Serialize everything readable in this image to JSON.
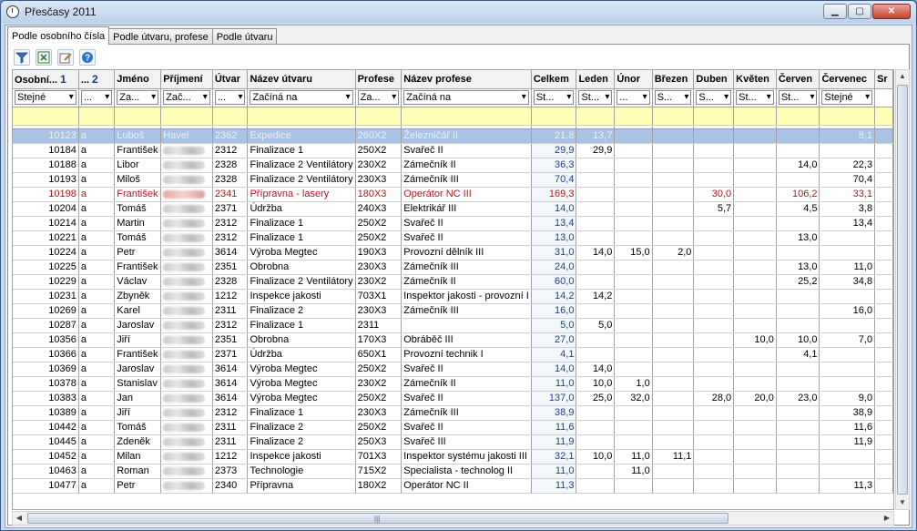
{
  "window": {
    "title": "Přesčasy 2011"
  },
  "tabs": [
    "Podle osobního čísla",
    "Podle útvaru, profese",
    "Podle útvaru"
  ],
  "toolbar": [
    "filter-icon",
    "excel-export-icon",
    "edit-icon",
    "help-icon"
  ],
  "columns": [
    "Osobní...",
    "...",
    "Jméno",
    "Příjmení",
    "Útvar",
    "Název útvaru",
    "Profese",
    "Název profese",
    "Celkem",
    "Leden",
    "Únor",
    "Březen",
    "Duben",
    "Květen",
    "Červen",
    "Červenec",
    "Sr"
  ],
  "sort_marks": [
    "1",
    "2"
  ],
  "filters": [
    "Stejné",
    "...",
    "Za...",
    "Zač...",
    "...",
    "Začíná na",
    "Za...",
    "Začíná na",
    "St...",
    "St...",
    "...",
    "S...",
    "S...",
    "St...",
    "St...",
    "Stejné",
    ""
  ],
  "rows": [
    {
      "cells": [
        "10123",
        "a",
        "Luboš",
        "Havel",
        "2362",
        "Expedice",
        "260X2",
        "Železničář II",
        "21,8",
        "13,7",
        "",
        "",
        "",
        "",
        "",
        "8,1"
      ],
      "state": "selected"
    },
    {
      "cells": [
        "10184",
        "a",
        "František",
        "",
        "2312",
        "Finalizace 1",
        "250X2",
        "Svařeč II",
        "29,9",
        "29,9",
        "",
        "",
        "",
        "",
        "",
        ""
      ]
    },
    {
      "cells": [
        "10188",
        "a",
        "Libor",
        "",
        "2328",
        "Finalizace 2 Ventilátory",
        "230X2",
        "Zámečník II",
        "36,3",
        "",
        "",
        "",
        "",
        "",
        "14,0",
        "22,3"
      ]
    },
    {
      "cells": [
        "10193",
        "a",
        "Miloš",
        "",
        "2328",
        "Finalizace 2 Ventilátory",
        "230X3",
        "Zámečník III",
        "70,4",
        "",
        "",
        "",
        "",
        "",
        "",
        "70,4"
      ]
    },
    {
      "cells": [
        "10198",
        "a",
        "František",
        "",
        "2341",
        "Přípravna - lasery",
        "180X3",
        "Operátor NC III",
        "169,3",
        "",
        "",
        "",
        "30,0",
        "",
        "106,2",
        "33,1"
      ],
      "state": "red"
    },
    {
      "cells": [
        "10204",
        "a",
        "Tomáš",
        "",
        "2371",
        "Údržba",
        "240X3",
        "Elektrikář III",
        "14,0",
        "",
        "",
        "",
        "5,7",
        "",
        "4,5",
        "3,8"
      ]
    },
    {
      "cells": [
        "10214",
        "a",
        "Martin",
        "",
        "2312",
        "Finalizace 1",
        "250X2",
        "Svařeč II",
        "13,4",
        "",
        "",
        "",
        "",
        "",
        "",
        "13,4"
      ]
    },
    {
      "cells": [
        "10221",
        "a",
        "Tomáš",
        "",
        "2312",
        "Finalizace 1",
        "250X2",
        "Svařeč II",
        "13,0",
        "",
        "",
        "",
        "",
        "",
        "13,0",
        ""
      ]
    },
    {
      "cells": [
        "10224",
        "a",
        "Petr",
        "",
        "3614",
        "Výroba Megtec",
        "190X3",
        "Provozní dělník III",
        "31,0",
        "14,0",
        "15,0",
        "2,0",
        "",
        "",
        "",
        ""
      ]
    },
    {
      "cells": [
        "10225",
        "a",
        "František",
        "",
        "2351",
        "Obrobna",
        "230X3",
        "Zámečník III",
        "24,0",
        "",
        "",
        "",
        "",
        "",
        "13,0",
        "11,0"
      ]
    },
    {
      "cells": [
        "10229",
        "a",
        "Václav",
        "",
        "2328",
        "Finalizace 2 Ventilátory",
        "230X2",
        "Zámečník II",
        "60,0",
        "",
        "",
        "",
        "",
        "",
        "25,2",
        "34,8"
      ]
    },
    {
      "cells": [
        "10231",
        "a",
        "Zbyněk",
        "",
        "1212",
        "Inspekce jakosti",
        "703X1",
        "Inspektor jakosti - provozní I",
        "14,2",
        "14,2",
        "",
        "",
        "",
        "",
        "",
        ""
      ]
    },
    {
      "cells": [
        "10269",
        "a",
        "Karel",
        "",
        "2311",
        "Finalizace 2",
        "230X3",
        "Zámečník III",
        "16,0",
        "",
        "",
        "",
        "",
        "",
        "",
        "16,0"
      ]
    },
    {
      "cells": [
        "10287",
        "a",
        "Jaroslav",
        "",
        "2312",
        "Finalizace 1",
        "2311",
        "",
        "5,0",
        "5,0",
        "",
        "",
        "",
        "",
        "",
        ""
      ]
    },
    {
      "cells": [
        "10356",
        "a",
        "Jiří",
        "",
        "2351",
        "Obrobna",
        "170X3",
        "Obráběč III",
        "27,0",
        "",
        "",
        "",
        "",
        "10,0",
        "10,0",
        "7,0"
      ]
    },
    {
      "cells": [
        "10366",
        "a",
        "František",
        "",
        "2371",
        "Údržba",
        "650X1",
        "Provozní technik I",
        "4,1",
        "",
        "",
        "",
        "",
        "",
        "4,1",
        ""
      ]
    },
    {
      "cells": [
        "10369",
        "a",
        "Jaroslav",
        "",
        "3614",
        "Výroba Megtec",
        "250X2",
        "Svařeč II",
        "14,0",
        "14,0",
        "",
        "",
        "",
        "",
        "",
        ""
      ]
    },
    {
      "cells": [
        "10378",
        "a",
        "Stanislav",
        "",
        "3614",
        "Výroba Megtec",
        "230X2",
        "Zámečník II",
        "11,0",
        "10,0",
        "1,0",
        "",
        "",
        "",
        "",
        ""
      ]
    },
    {
      "cells": [
        "10383",
        "a",
        "Jan",
        "",
        "3614",
        "Výroba Megtec",
        "250X2",
        "Svařeč II",
        "137,0",
        "25,0",
        "32,0",
        "",
        "28,0",
        "20,0",
        "23,0",
        "9,0"
      ]
    },
    {
      "cells": [
        "10389",
        "a",
        "Jiří",
        "",
        "2312",
        "Finalizace 1",
        "230X3",
        "Zámečník III",
        "38,9",
        "",
        "",
        "",
        "",
        "",
        "",
        "38,9"
      ]
    },
    {
      "cells": [
        "10442",
        "a",
        "Tomáš",
        "",
        "2311",
        "Finalizace 2",
        "250X2",
        "Svařeč II",
        "11,6",
        "",
        "",
        "",
        "",
        "",
        "",
        "11,6"
      ]
    },
    {
      "cells": [
        "10445",
        "a",
        "Zdeněk",
        "",
        "2311",
        "Finalizace 2",
        "250X3",
        "Svařeč III",
        "11,9",
        "",
        "",
        "",
        "",
        "",
        "",
        "11,9"
      ]
    },
    {
      "cells": [
        "10452",
        "a",
        "Milan",
        "",
        "1212",
        "Inspekce jakosti",
        "701X3",
        "Inspektor systému jakosti III",
        "32,1",
        "10,0",
        "11,0",
        "11,1",
        "",
        "",
        "",
        ""
      ]
    },
    {
      "cells": [
        "10463",
        "a",
        "Roman",
        "",
        "2373",
        "Technologie",
        "715X2",
        "Specialista - technolog II",
        "11,0",
        "",
        "11,0",
        "",
        "",
        "",
        "",
        ""
      ]
    },
    {
      "cells": [
        "10477",
        "a",
        "Petr",
        "",
        "2340",
        "Přípravna",
        "180X2",
        "Operátor NC II",
        "11,3",
        "",
        "",
        "",
        "",
        "",
        "",
        "11,3"
      ]
    }
  ],
  "colors": {
    "selected_row": "#a9c3e6",
    "warning_text": "#b01818",
    "filter_row": "#ffffb8"
  }
}
